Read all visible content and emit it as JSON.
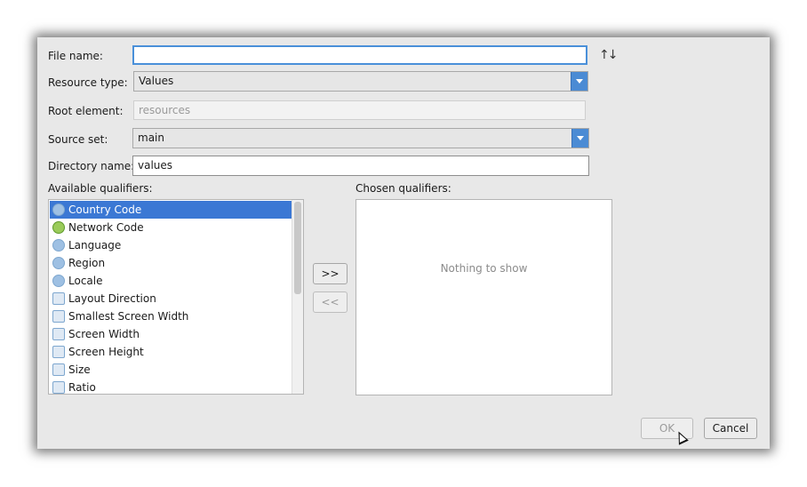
{
  "form": {
    "file_name_label": "File name:",
    "file_name_value": "",
    "resource_type_label": "Resource type:",
    "resource_type_value": "Values",
    "root_element_label": "Root element:",
    "root_element_placeholder": "resources",
    "source_set_label": "Source set:",
    "source_set_value": "main",
    "directory_name_label": "Directory name:",
    "directory_name_value": "values",
    "sort_icon": "sort-arrows-icon"
  },
  "qualifiers": {
    "available_label": "Available qualifiers:",
    "chosen_label": "Chosen qualifiers:",
    "chosen_empty": "Nothing to show",
    "items": [
      {
        "label": "Country Code",
        "icon": "globe-icon",
        "selected": true
      },
      {
        "label": "Network Code",
        "icon": "network-icon"
      },
      {
        "label": "Language",
        "icon": "globe-icon"
      },
      {
        "label": "Region",
        "icon": "region-icon"
      },
      {
        "label": "Locale",
        "icon": "locale-icon"
      },
      {
        "label": "Layout Direction",
        "icon": "layout-direction-icon"
      },
      {
        "label": "Smallest Screen Width",
        "icon": "smallest-width-icon"
      },
      {
        "label": "Screen Width",
        "icon": "screen-width-icon"
      },
      {
        "label": "Screen Height",
        "icon": "screen-height-icon"
      },
      {
        "label": "Size",
        "icon": "size-icon"
      },
      {
        "label": "Ratio",
        "icon": "ratio-icon"
      }
    ],
    "add_button": ">>",
    "remove_button": "<<"
  },
  "buttons": {
    "ok": "OK",
    "cancel": "Cancel"
  }
}
